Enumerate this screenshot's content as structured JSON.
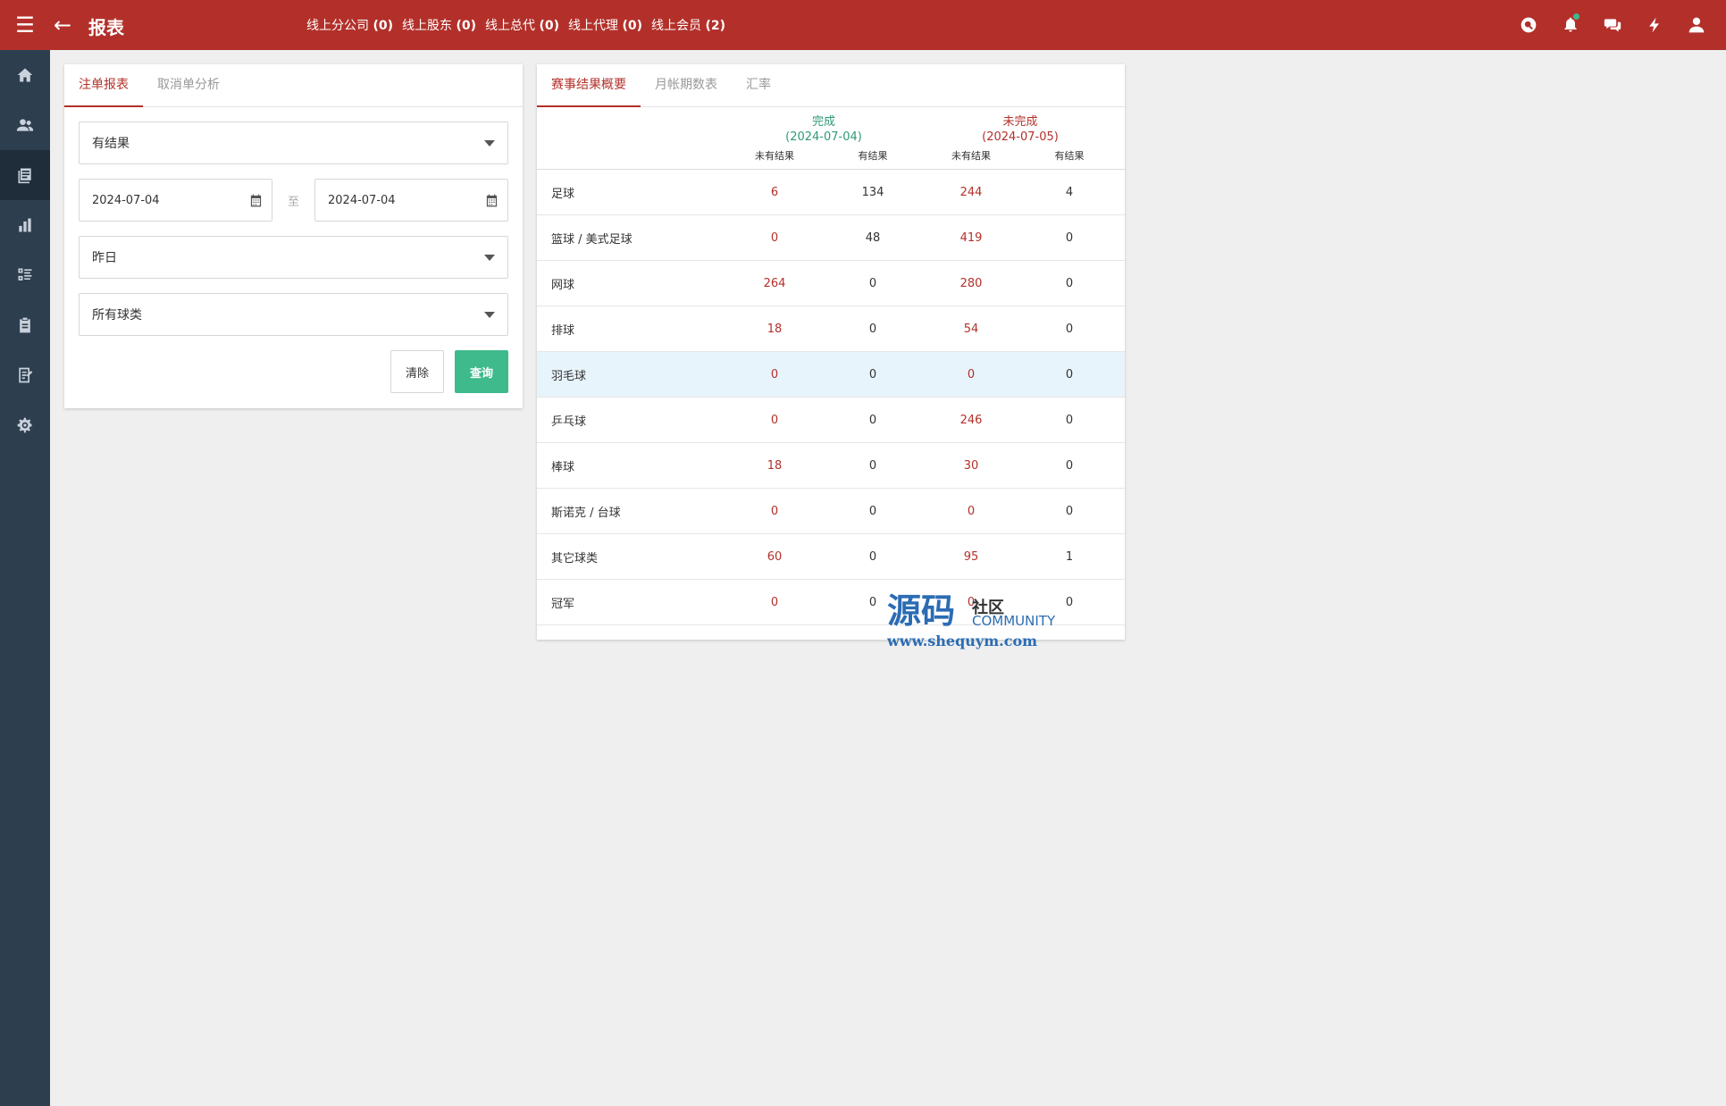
{
  "header": {
    "title": "报表",
    "stats": [
      {
        "label": "线上分公司",
        "count": "(0)"
      },
      {
        "label": "线上股东",
        "count": "(0)"
      },
      {
        "label": "线上总代",
        "count": "(0)"
      },
      {
        "label": "线上代理",
        "count": "(0)"
      },
      {
        "label": "线上会员",
        "count": "(2)"
      }
    ],
    "icons": [
      "search-icon",
      "bell-icon",
      "chat-icon",
      "lightning-icon",
      "user-icon"
    ],
    "accent": "#b3302a"
  },
  "sidebar": {
    "items": [
      "home-icon",
      "users-icon",
      "report-icon",
      "bar-chart-icon",
      "list-icon",
      "clipboard-icon",
      "ledger-icon",
      "settings-icon"
    ],
    "active_index": 2
  },
  "filter": {
    "tabs": [
      "注单报表",
      "取消单分析"
    ],
    "result_select": "有结果",
    "date_from": "2024-07-04",
    "date_sep": "至",
    "date_to": "2024-07-04",
    "period_select": "昨日",
    "sport_select": "所有球类",
    "clear_label": "清除",
    "query_label": "查询"
  },
  "summary": {
    "tabs": [
      "赛事结果概要",
      "月帐期数表",
      "汇率"
    ],
    "groups": [
      {
        "label": "完成",
        "date": "(2024-07-04)"
      },
      {
        "label": "未完成",
        "date": "(2024-07-05)"
      }
    ],
    "subheaders": [
      "未有结果",
      "有结果",
      "未有结果",
      "有结果"
    ],
    "rows": [
      {
        "name": "足球",
        "values": [
          "6",
          "134",
          "244",
          "4"
        ]
      },
      {
        "name": "篮球 / 美式足球",
        "values": [
          "0",
          "48",
          "419",
          "0"
        ]
      },
      {
        "name": "网球",
        "values": [
          "264",
          "0",
          "280",
          "0"
        ]
      },
      {
        "name": "排球",
        "values": [
          "18",
          "0",
          "54",
          "0"
        ]
      },
      {
        "name": "羽毛球",
        "values": [
          "0",
          "0",
          "0",
          "0"
        ]
      },
      {
        "name": "乒乓球",
        "values": [
          "0",
          "0",
          "246",
          "0"
        ]
      },
      {
        "name": "棒球",
        "values": [
          "18",
          "0",
          "30",
          "0"
        ]
      },
      {
        "name": "斯诺克 / 台球",
        "values": [
          "0",
          "0",
          "0",
          "0"
        ]
      },
      {
        "name": "其它球类",
        "values": [
          "60",
          "0",
          "95",
          "1"
        ]
      },
      {
        "name": "冠军",
        "values": [
          "0",
          "0",
          "0",
          "0"
        ]
      }
    ]
  },
  "watermark": {
    "big": "源码",
    "small": "社区",
    "community": "COMMUNITY",
    "url": "www.shequym.com"
  }
}
